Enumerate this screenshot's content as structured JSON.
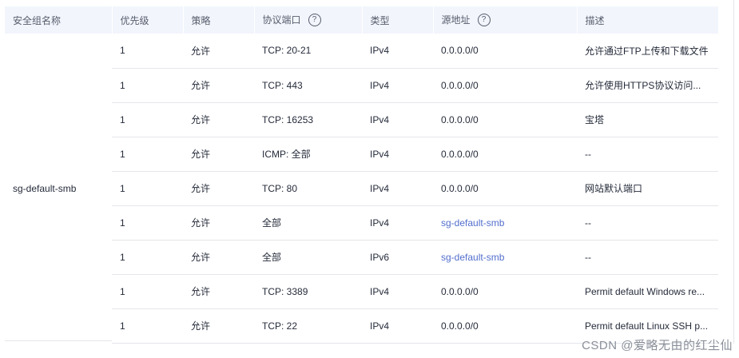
{
  "columns": {
    "name": "安全组名称",
    "priority": "优先级",
    "policy": "策略",
    "port": "协议端口",
    "type": "类型",
    "source": "源地址",
    "desc": "描述"
  },
  "help_glyph": "?",
  "group_name": "sg-default-smb",
  "rows": [
    {
      "priority": "1",
      "policy": "允许",
      "port": "TCP: 20-21",
      "type": "IPv4",
      "source": "0.0.0.0/0",
      "source_link": false,
      "desc": "允许通过FTP上传和下载文件"
    },
    {
      "priority": "1",
      "policy": "允许",
      "port": "TCP: 443",
      "type": "IPv4",
      "source": "0.0.0.0/0",
      "source_link": false,
      "desc": "允许使用HTTPS协议访问..."
    },
    {
      "priority": "1",
      "policy": "允许",
      "port": "TCP: 16253",
      "type": "IPv4",
      "source": "0.0.0.0/0",
      "source_link": false,
      "desc": "宝塔"
    },
    {
      "priority": "1",
      "policy": "允许",
      "port": "ICMP: 全部",
      "type": "IPv4",
      "source": "0.0.0.0/0",
      "source_link": false,
      "desc": "--"
    },
    {
      "priority": "1",
      "policy": "允许",
      "port": "TCP: 80",
      "type": "IPv4",
      "source": "0.0.0.0/0",
      "source_link": false,
      "desc": "网站默认端口"
    },
    {
      "priority": "1",
      "policy": "允许",
      "port": "全部",
      "type": "IPv4",
      "source": "sg-default-smb",
      "source_link": true,
      "desc": "--"
    },
    {
      "priority": "1",
      "policy": "允许",
      "port": "全部",
      "type": "IPv6",
      "source": "sg-default-smb",
      "source_link": true,
      "desc": "--"
    },
    {
      "priority": "1",
      "policy": "允许",
      "port": "TCP: 3389",
      "type": "IPv4",
      "source": "0.0.0.0/0",
      "source_link": false,
      "desc": "Permit default Windows re..."
    },
    {
      "priority": "1",
      "policy": "允许",
      "port": "TCP: 22",
      "type": "IPv4",
      "source": "0.0.0.0/0",
      "source_link": false,
      "desc": "Permit default Linux SSH p..."
    }
  ],
  "watermark": "CSDN @爱略无由的红尘仙",
  "colors": {
    "header_bg": "#f2f5fc",
    "link": "#526ecc",
    "border": "#e5e6eb",
    "text": "#252b3a"
  }
}
